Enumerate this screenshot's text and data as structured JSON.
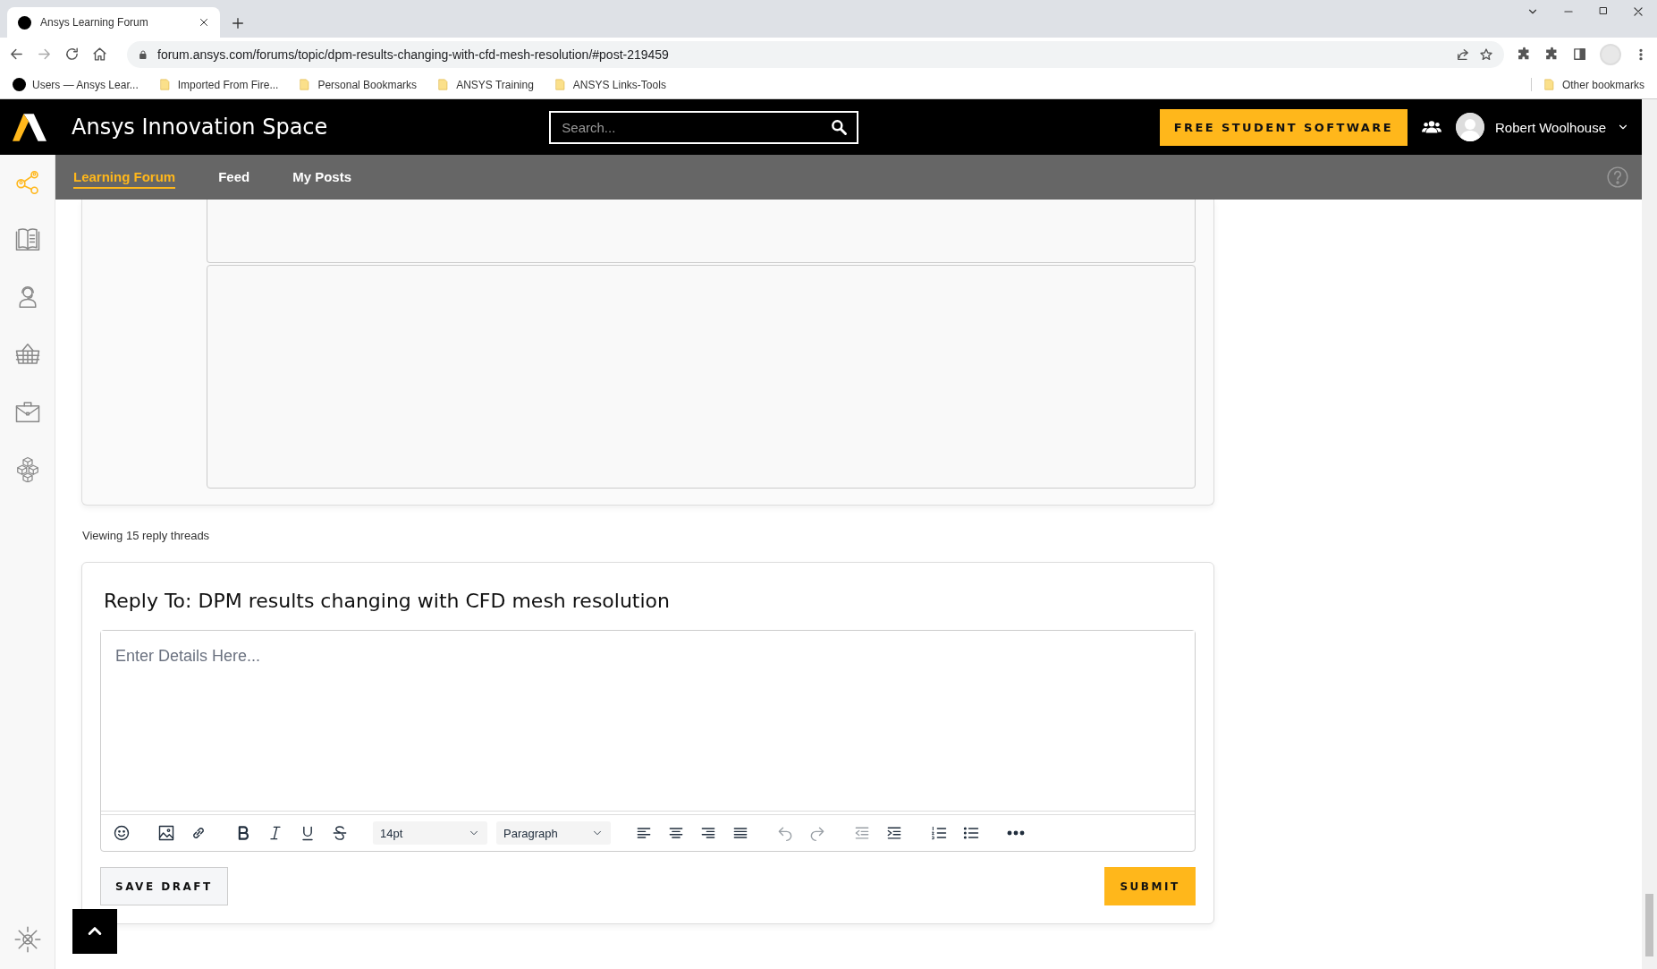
{
  "browser": {
    "tab": {
      "title": "Ansys Learning Forum"
    },
    "address": "forum.ansys.com/forums/topic/dpm-results-changing-with-cfd-mesh-resolution/#post-219459",
    "bookmarks": [
      {
        "label": "Users — Ansys Lear...",
        "kind": "site"
      },
      {
        "label": "Imported From Fire...",
        "kind": "folder"
      },
      {
        "label": "Personal Bookmarks",
        "kind": "folder"
      },
      {
        "label": "ANSYS Training",
        "kind": "folder"
      },
      {
        "label": "ANSYS Links-Tools",
        "kind": "folder"
      }
    ],
    "other_bookmarks": "Other bookmarks"
  },
  "header": {
    "title": "Ansys Innovation Space",
    "search": {
      "placeholder": "Search..."
    },
    "cta": "FREE STUDENT SOFTWARE",
    "user": "Robert Woolhouse"
  },
  "nav": {
    "tabs": [
      {
        "label": "Learning Forum",
        "selected": true
      },
      {
        "label": "Feed",
        "selected": false
      },
      {
        "label": "My Posts",
        "selected": false
      }
    ]
  },
  "sidebar": {
    "items": [
      {
        "kind": "network",
        "selected": true
      },
      {
        "kind": "book",
        "selected": false
      },
      {
        "kind": "support",
        "selected": false
      },
      {
        "kind": "basket",
        "selected": false
      },
      {
        "kind": "briefcase",
        "selected": false
      },
      {
        "kind": "cubes",
        "selected": false
      }
    ]
  },
  "thread": {
    "viewing": "Viewing 15 reply threads"
  },
  "reply": {
    "title": "Reply To: DPM results changing with CFD mesh resolution",
    "editor": {
      "placeholder": "Enter Details Here...",
      "toolbar": [
        [
          {
            "kind": "emoji",
            "disabled": false
          }
        ],
        [
          {
            "kind": "image",
            "disabled": false
          },
          {
            "kind": "link",
            "disabled": false
          }
        ],
        [
          {
            "kind": "bold",
            "disabled": false
          },
          {
            "kind": "italic",
            "disabled": false
          },
          {
            "kind": "underline",
            "disabled": false
          },
          {
            "kind": "strike",
            "disabled": false
          }
        ],
        [
          {
            "kind": "select",
            "value": "14pt",
            "disabled": false
          },
          {
            "kind": "select",
            "value": "Paragraph",
            "disabled": false
          }
        ],
        [
          {
            "kind": "align-left",
            "disabled": false
          },
          {
            "kind": "align-center",
            "disabled": false
          },
          {
            "kind": "align-right",
            "disabled": false
          },
          {
            "kind": "justify",
            "disabled": false
          }
        ],
        [
          {
            "kind": "undo",
            "disabled": true
          },
          {
            "kind": "redo",
            "disabled": true
          }
        ],
        [
          {
            "kind": "outdent",
            "disabled": true
          },
          {
            "kind": "indent",
            "disabled": false
          }
        ],
        [
          {
            "kind": "ordered-list",
            "disabled": false
          },
          {
            "kind": "bullet-list",
            "disabled": false
          }
        ],
        [
          {
            "kind": "more",
            "disabled": false
          }
        ]
      ]
    },
    "save_label": "SAVE DRAFT",
    "submit_label": "SUBMIT"
  }
}
